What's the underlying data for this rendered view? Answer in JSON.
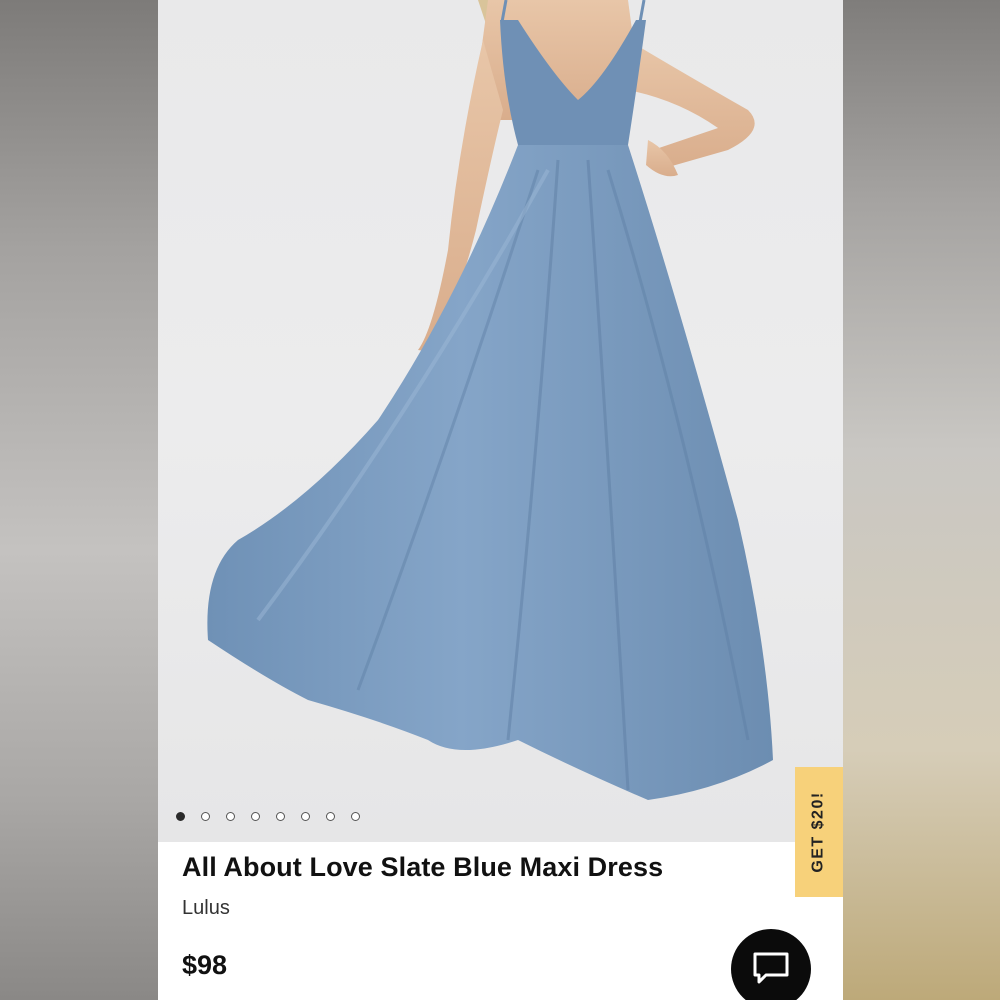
{
  "product": {
    "title": "All About Love Slate Blue Maxi Dress",
    "brand": "Lulus",
    "price": "$98",
    "image_alt": "Slate blue maxi dress on model"
  },
  "gallery": {
    "image_count": 8,
    "active_index": 0
  },
  "promo": {
    "label": "GET $20!"
  },
  "chat": {
    "icon": "chat-icon"
  },
  "colors": {
    "dress": "#7b9cbf",
    "promo_bg": "#f7d17a",
    "chat_bg": "#0b0b0b"
  }
}
